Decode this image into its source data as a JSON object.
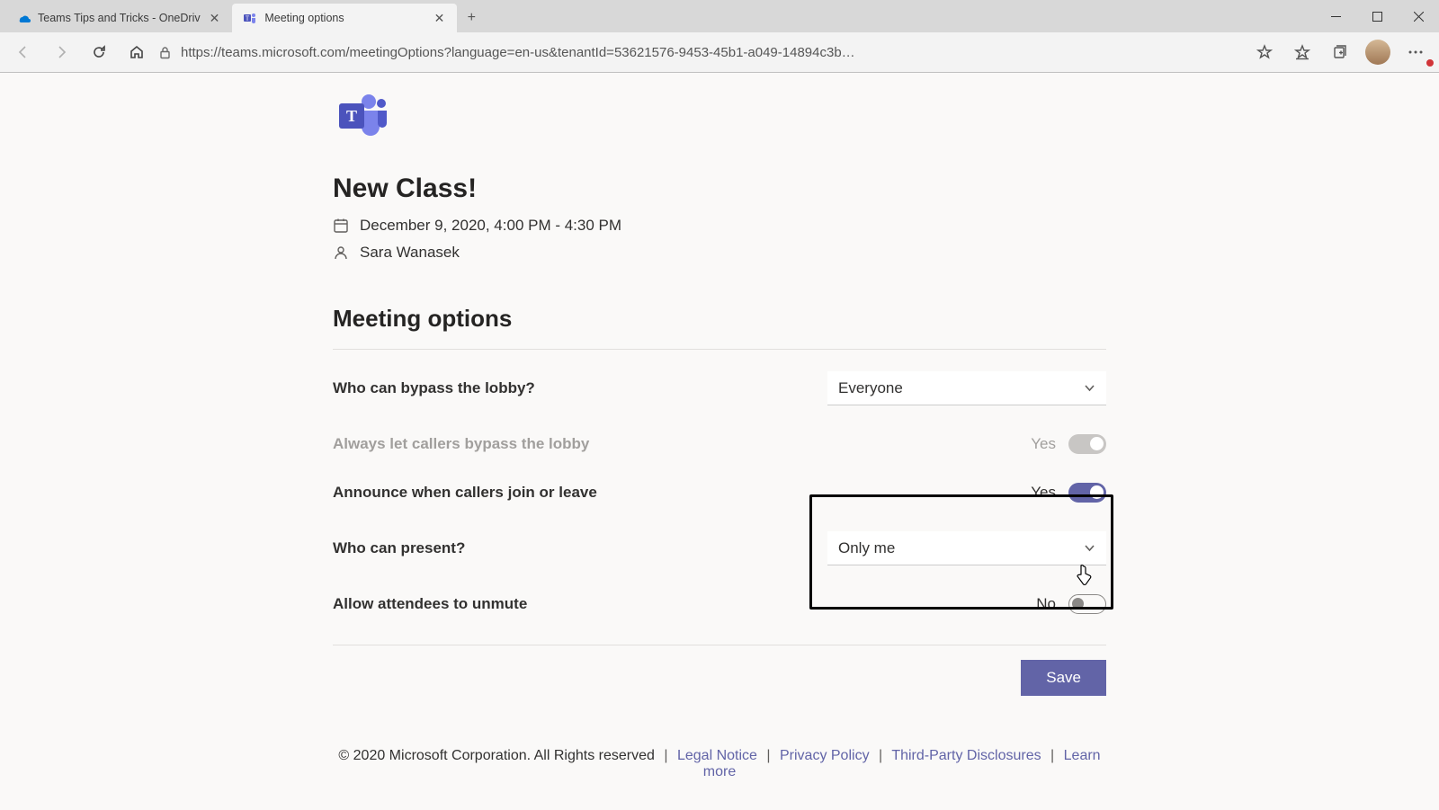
{
  "browser": {
    "tabs": [
      {
        "label": "Teams Tips and Tricks - OneDriv",
        "active": false
      },
      {
        "label": "Meeting options",
        "active": true
      }
    ],
    "url": "https://teams.microsoft.com/meetingOptions?language=en-us&tenantId=53621576-9453-45b1-a049-14894c3b…"
  },
  "meeting": {
    "title": "New Class!",
    "datetime": "December 9, 2020, 4:00 PM - 4:30 PM",
    "organizer": "Sara Wanasek"
  },
  "section_title": "Meeting options",
  "options": {
    "bypass_lobby": {
      "label": "Who can bypass the lobby?",
      "value": "Everyone"
    },
    "callers_bypass": {
      "label": "Always let callers bypass the lobby",
      "value": "Yes"
    },
    "announce": {
      "label": "Announce when callers join or leave",
      "value": "Yes"
    },
    "present": {
      "label": "Who can present?",
      "value": "Only me"
    },
    "unmute": {
      "label": "Allow attendees to unmute",
      "value": "No"
    }
  },
  "save_label": "Save",
  "footer": {
    "copyright": "© 2020 Microsoft Corporation. All Rights reserved",
    "links": [
      "Legal Notice",
      "Privacy Policy",
      "Third-Party Disclosures",
      "Learn more"
    ]
  }
}
